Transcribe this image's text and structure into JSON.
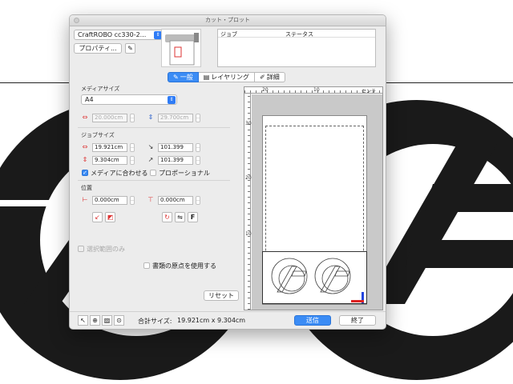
{
  "window": {
    "title": "カット・プロット"
  },
  "device": {
    "selected": "CraftROBO cc330-2...",
    "properties_label": "プロパティ..."
  },
  "job_list": {
    "columns": [
      "ジョブ",
      "ステータス"
    ]
  },
  "tabs": [
    {
      "label": "一般",
      "icon": "knife-icon",
      "active": true
    },
    {
      "label": "レイヤリング",
      "icon": "layer-icon",
      "active": false
    },
    {
      "label": "詳細",
      "icon": "pen-icon",
      "active": false
    }
  ],
  "media": {
    "heading": "メディアサイズ",
    "selected": "A4",
    "width": "20.000cm",
    "height": "29.700cm"
  },
  "job_size": {
    "heading": "ジョブサイズ",
    "width": "19.921cm",
    "height": "9.304cm",
    "scale_x": "101.399",
    "scale_y": "101.399",
    "fit_media_label": "メディアに合わせる",
    "fit_media_checked": true,
    "proportional_label": "プロポーショナル",
    "proportional_checked": false
  },
  "position": {
    "heading": "位置",
    "x": "0.000cm",
    "y": "0.000cm",
    "f_button": "F"
  },
  "options": {
    "selection_only": "選択範囲のみ",
    "use_doc_origin": "書類の原点を使用する"
  },
  "reset_label": "リセット",
  "preview": {
    "ruler_top": [
      "20",
      "10",
      "センチ"
    ],
    "ruler_left": [
      "30",
      "20",
      "10"
    ]
  },
  "status": {
    "total_size_label": "合計サイズ:",
    "total_size_value": "19.921cm x 9.304cm"
  },
  "buttons": {
    "send": "送信",
    "close": "終了"
  },
  "colors": {
    "accent": "#3b8cf5",
    "artwork": "#1a1a1a"
  }
}
